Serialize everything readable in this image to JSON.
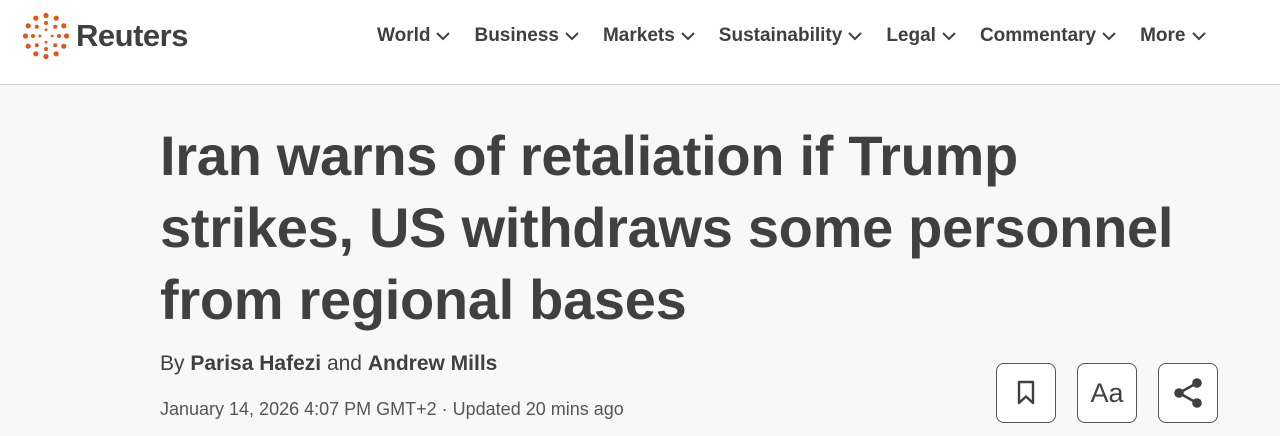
{
  "brand": {
    "name": "Reuters",
    "accent_color": "#e0561b"
  },
  "nav": {
    "items": [
      {
        "label": "World",
        "icon": "chevron-down-icon"
      },
      {
        "label": "Business",
        "icon": "chevron-down-icon"
      },
      {
        "label": "Markets",
        "icon": "chevron-down-icon"
      },
      {
        "label": "Sustainability",
        "icon": "chevron-down-icon"
      },
      {
        "label": "Legal",
        "icon": "chevron-down-icon"
      },
      {
        "label": "Commentary",
        "icon": "chevron-down-icon"
      },
      {
        "label": "More",
        "icon": "chevron-down-icon"
      }
    ]
  },
  "article": {
    "headline": "Iran warns of retaliation if Trump strikes, US withdraws some personnel from regional bases",
    "byline": {
      "prefix": "By",
      "author1": "Parisa Hafezi",
      "conjunction": "and",
      "author2": "Andrew Mills"
    },
    "dateline": "January 14, 2026 4:07 PM GMT+2 · Updated 20 mins ago"
  },
  "tools": {
    "bookmark_icon": "bookmark-icon",
    "text_size_label": "Aa",
    "share_icon": "share-icon"
  }
}
